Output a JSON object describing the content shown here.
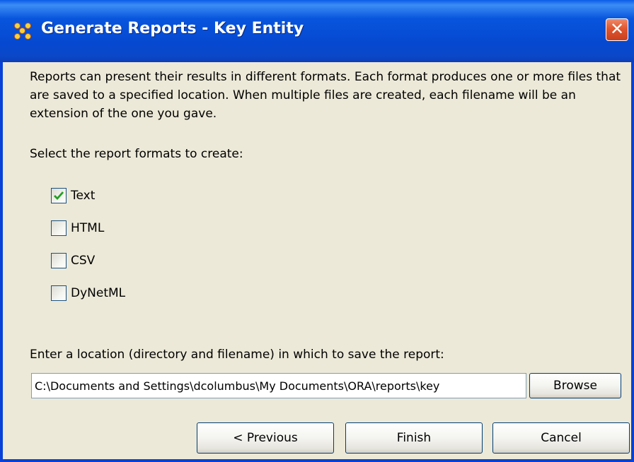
{
  "window": {
    "title": "Generate Reports - Key Entity",
    "close_label": "✕",
    "app_icon": "ora-network-icon"
  },
  "description": "Reports can present their results in different formats. Each format produces one or more files that are saved to a specified location. When multiple files are created, each filename will be an extension of the one you gave.",
  "formats": {
    "label": "Select the report formats to create:",
    "options": [
      {
        "label": "Text",
        "checked": true
      },
      {
        "label": "HTML",
        "checked": false
      },
      {
        "label": "CSV",
        "checked": false
      },
      {
        "label": "DyNetML",
        "checked": false
      }
    ]
  },
  "location": {
    "label": "Enter a location (directory and filename) in which to save the report:",
    "value": "C:\\Documents and Settings\\dcolumbus\\My Documents\\ORA\\reports\\key",
    "browse_label": "Browse"
  },
  "buttons": {
    "previous": "< Previous",
    "finish": "Finish",
    "cancel": "Cancel"
  },
  "colors": {
    "titlebar": "#0855dd",
    "window_bg": "#ece9d8",
    "close": "#e0562f",
    "checkmark": "#21a121"
  }
}
